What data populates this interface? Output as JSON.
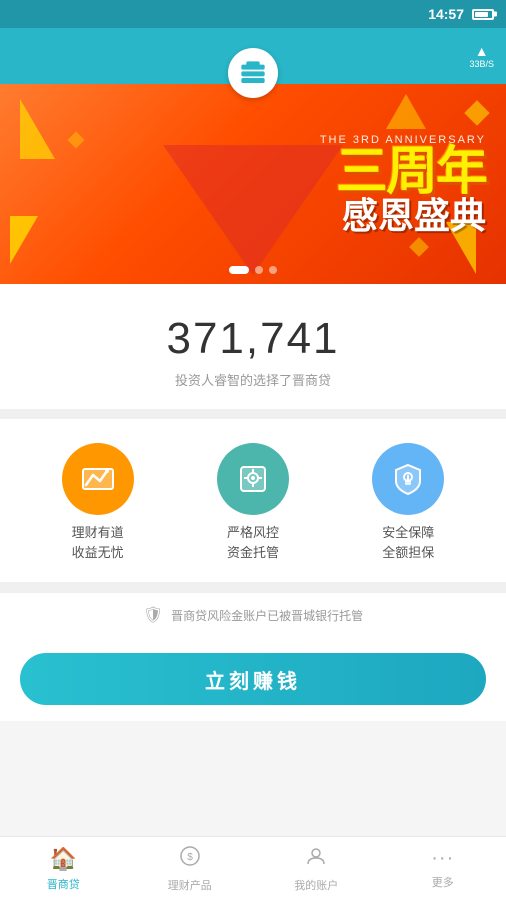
{
  "statusBar": {
    "time": "14:57",
    "batteryLevel": "70",
    "speed": "33B/S"
  },
  "header": {
    "logoAlt": "晋商贷 Logo"
  },
  "banner": {
    "anniversaryLine": "THE 3RD ANNIVERSARY",
    "mainText": "三周年",
    "subText": "感恩盛典",
    "dots": [
      {
        "active": true
      },
      {
        "active": false
      },
      {
        "active": false
      }
    ]
  },
  "stats": {
    "number": "371,741",
    "description": "投资人睿智的选择了晋商贷"
  },
  "features": [
    {
      "id": "finance",
      "icon": "📈",
      "iconClass": "icon-orange",
      "line1": "理财有道",
      "line2": "收益无忧"
    },
    {
      "id": "risk",
      "icon": "🔒",
      "iconClass": "icon-green",
      "line1": "严格风控",
      "line2": "资金托管"
    },
    {
      "id": "security",
      "icon": "🛡",
      "iconClass": "icon-blue",
      "line1": "安全保障",
      "line2": "全额担保"
    }
  ],
  "trust": {
    "icon": "🛡",
    "text": "晋商贷风险金账户已被晋城银行托管"
  },
  "cta": {
    "label": "立刻赚钱"
  },
  "bottomNav": [
    {
      "id": "home",
      "icon": "🏠",
      "label": "晋商贷",
      "active": true
    },
    {
      "id": "products",
      "icon": "💰",
      "label": "理财产品",
      "active": false
    },
    {
      "id": "account",
      "icon": "👤",
      "label": "我的账户",
      "active": false
    },
    {
      "id": "more",
      "icon": "···",
      "label": "更多",
      "active": false
    }
  ]
}
